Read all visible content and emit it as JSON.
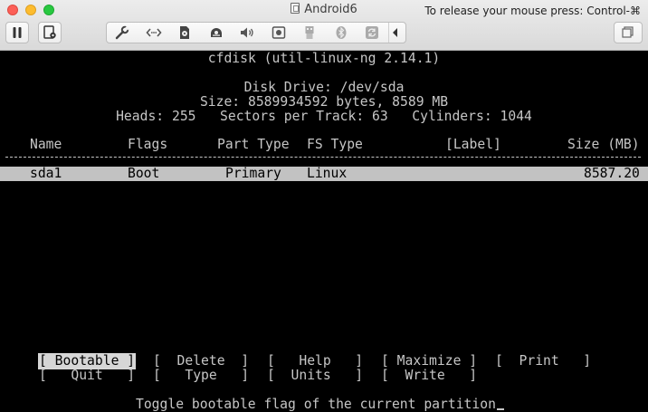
{
  "window": {
    "title": "Android6",
    "release_hint": "To release your mouse press: Control-⌘"
  },
  "toolbar": {
    "pause_icon": "pause-icon",
    "snapshot_icon": "snapshot-icon",
    "device_icons": [
      "wrench-icon",
      "code-arrows-icon",
      "cd-icon",
      "hard-disk-icon",
      "speaker-icon",
      "camera-icon",
      "usb-icon",
      "bluetooth-icon",
      "shared-folder-icon"
    ],
    "collapse_icon": "triangle-left-icon",
    "view_icon": "window-stack-icon"
  },
  "cfdisk": {
    "title": "cfdisk (util-linux-ng 2.14.1)",
    "disk_drive": "Disk Drive: /dev/sda",
    "size": "Size: 8589934592 bytes, 8589 MB",
    "geometry": "Heads: 255   Sectors per Track: 63   Cylinders: 1044",
    "columns": {
      "name": "Name",
      "flags": "Flags",
      "part_type": "Part Type",
      "fs_type": "FS Type",
      "label": "[Label]",
      "size": "Size (MB)"
    },
    "separator": "------------------------------------------------------------------------------",
    "partitions": [
      {
        "name": "sda1",
        "flags": "Boot",
        "part_type": "Primary",
        "fs_type": "Linux",
        "label": "",
        "size": "8587.20"
      }
    ],
    "menu": [
      [
        "[ Bootable ]",
        "[  Delete  ]",
        "[   Help   ]",
        "[ Maximize ]",
        "[  Print   ]"
      ],
      [
        "[   Quit   ]",
        "[   Type   ]",
        "[  Units   ]",
        "[  Write   ]"
      ]
    ],
    "status": "Toggle bootable flag of the current partition"
  }
}
